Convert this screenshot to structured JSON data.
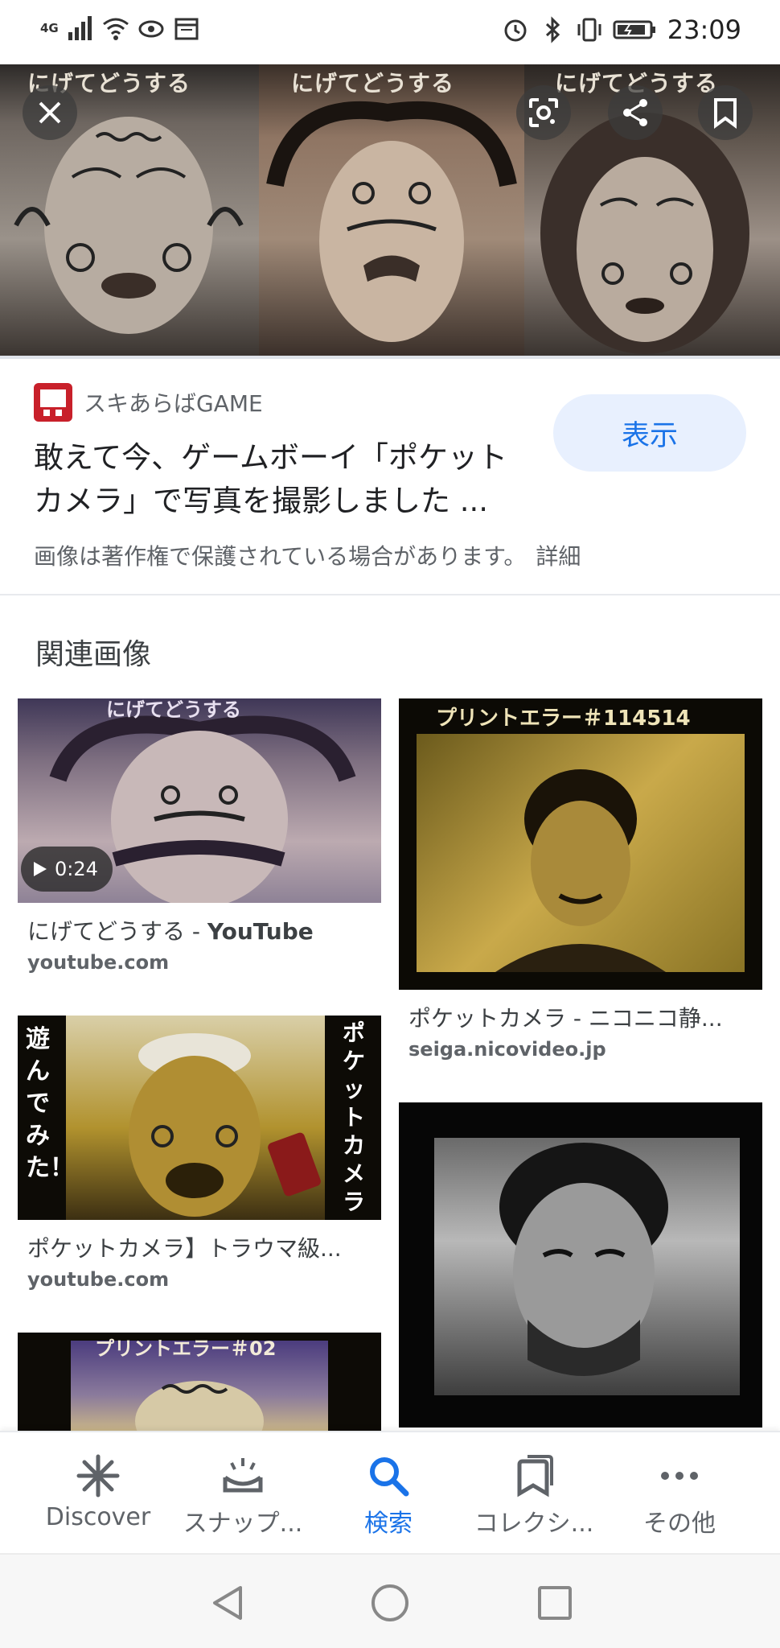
{
  "status_bar": {
    "network": "4G",
    "time": "23:09"
  },
  "hero": {
    "captions": [
      "にげてどうする",
      "にげてどうする",
      "にげてどうする"
    ]
  },
  "source": {
    "site_name": "スキあらばGAME",
    "title_line1": "敢えて今、ゲームボーイ「ポケット",
    "title_line2": "カメラ」で写真を撮影しました ...",
    "view_button": "表示",
    "notice": "画像は著作権で保護されている場合があります。",
    "detail_link": "詳細"
  },
  "related": {
    "heading": "関連画像",
    "cards": [
      {
        "title_plain": "にげてどうする - ",
        "title_bold": "YouTube",
        "domain": "youtube.com",
        "duration": "0:24",
        "overlay_text": "にげてどうする"
      },
      {
        "title_plain": "ポケットカメラ - ニコニコ静...",
        "title_bold": "",
        "domain": "seiga.nicovideo.jp",
        "overlay_text": "プリントエラー＃114514"
      },
      {
        "title_plain": "ポケットカメラ】トラウマ級...",
        "title_bold": "",
        "domain": "youtube.com",
        "overlay_left": "遊んでみた！",
        "overlay_right": "ポケットカメラで"
      },
      {
        "title_plain": "",
        "title_bold": "",
        "domain": "",
        "overlay_text": ""
      },
      {
        "title_plain": "",
        "title_bold": "",
        "domain": "",
        "overlay_text": "プリントエラー＃02"
      }
    ]
  },
  "bottom_nav": {
    "items": [
      {
        "label": "Discover",
        "icon": "asterisk-icon"
      },
      {
        "label": "スナップ...",
        "icon": "snapshot-icon"
      },
      {
        "label": "検索",
        "icon": "search-icon"
      },
      {
        "label": "コレクシ...",
        "icon": "collections-icon"
      },
      {
        "label": "その他",
        "icon": "more-icon"
      }
    ],
    "active": "検索"
  },
  "colors": {
    "accent": "#1a73e8",
    "view_button_bg": "#e8f0fe"
  }
}
